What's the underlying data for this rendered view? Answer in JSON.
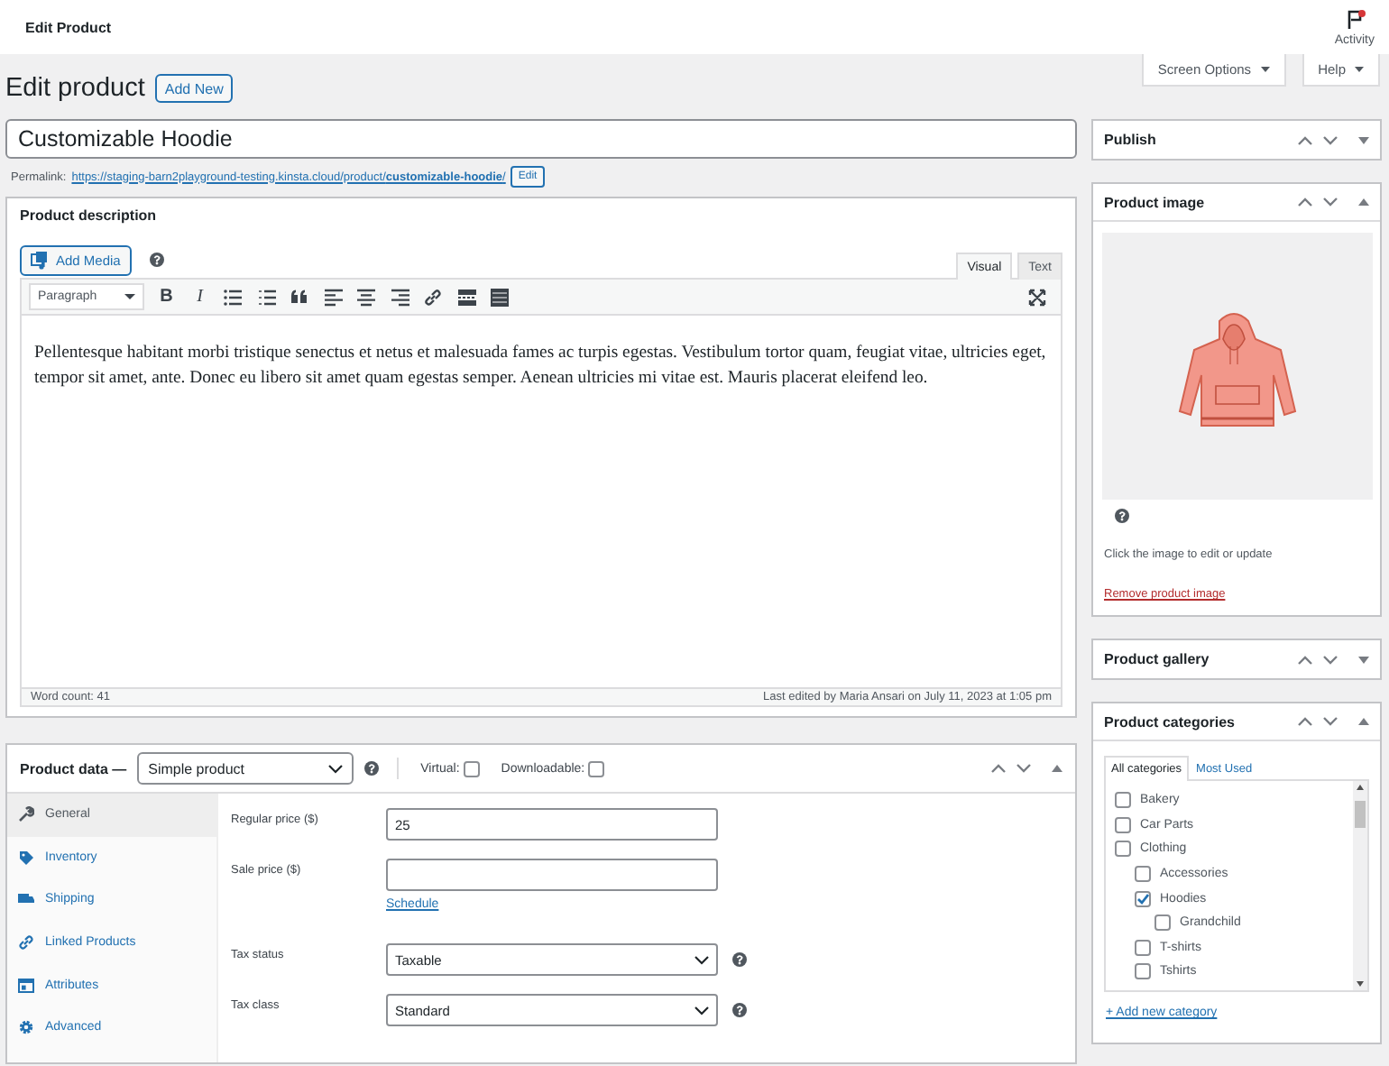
{
  "top_bar": {
    "title": "Edit Product",
    "activity": "Activity",
    "notification": true
  },
  "screen_tabs": [
    {
      "label": "Screen Options"
    },
    {
      "label": "Help"
    }
  ],
  "heading": {
    "title": "Edit product",
    "add_new": "Add New"
  },
  "title_field": {
    "value": "Customizable Hoodie"
  },
  "permalink": {
    "label": "Permalink:",
    "url": "https://staging-barn2playground-testing.kinsta.cloud/product/**customizable-hoodie**/",
    "edit": "Edit"
  },
  "description": {
    "title": "Product description",
    "add_media": "Add Media",
    "tabs": [
      {
        "label": "Visual",
        "selected": true
      },
      {
        "label": "Text",
        "selected": false
      }
    ],
    "format": "Paragraph",
    "bold": "B",
    "italic": "I",
    "content": "Pellentesque habitant morbi tristique senectus et netus et malesuada fames ac turpis egestas. Vestibulum tortor quam, feugiat vitae, ultricies eget, tempor sit amet, ante. Donec eu libero sit amet quam egestas semper. Aenean ultricies mi vitae est. Mauris placerat eleifend leo.",
    "word_count": "Word count: 41",
    "last_edited": "Last edited by Maria Ansari on July 11, 2023 at 1:05 pm"
  },
  "product_data": {
    "title": "Product data —",
    "type": "Simple product",
    "expanded": true,
    "options": [
      {
        "label": "Virtual:",
        "checked": false
      },
      {
        "label": "Downloadable:",
        "checked": false
      }
    ],
    "tabs": [
      {
        "label": "General",
        "selected": true
      },
      {
        "label": "Inventory",
        "selected": false
      },
      {
        "label": "Shipping",
        "selected": false
      },
      {
        "label": "Linked Products",
        "selected": false
      },
      {
        "label": "Attributes",
        "selected": false
      },
      {
        "label": "Advanced",
        "selected": false
      }
    ],
    "fields": [
      {
        "kind": "text",
        "label": "Regular price ($)",
        "value": "25"
      },
      {
        "kind": "text",
        "label": "Sale price ($)",
        "link": "Schedule"
      },
      {
        "kind": "select",
        "label": "Tax status",
        "value": "Taxable"
      },
      {
        "kind": "select",
        "label": "Tax class",
        "value": "Standard"
      }
    ]
  },
  "sidebar": [
    {
      "title": "Publish",
      "expanded": false
    },
    {
      "kind": "image",
      "title": "Product image",
      "expanded": true,
      "hint": "Click the image to edit or update",
      "remove": "Remove product image"
    },
    {
      "title": "Product gallery",
      "expanded": false
    },
    {
      "kind": "categories",
      "title": "Product categories",
      "expanded": true,
      "tabs": [
        {
          "label": "All categories",
          "selected": true
        },
        {
          "label": "Most Used",
          "selected": false
        }
      ],
      "items": [
        {
          "label": "Bakery",
          "checked": false
        },
        {
          "label": "Car Parts",
          "checked": false
        },
        {
          "label": "Clothing",
          "checked": false,
          "children": [
            {
              "label": "Accessories",
              "checked": false
            },
            {
              "label": "Hoodies",
              "checked": true,
              "children": [
                {
                  "label": "Grandchild",
                  "checked": false
                }
              ]
            },
            {
              "label": "T-shirts",
              "checked": false
            },
            {
              "label": "Tshirts",
              "checked": false
            }
          ]
        }
      ],
      "add_link": "+ Add new category"
    }
  ]
}
